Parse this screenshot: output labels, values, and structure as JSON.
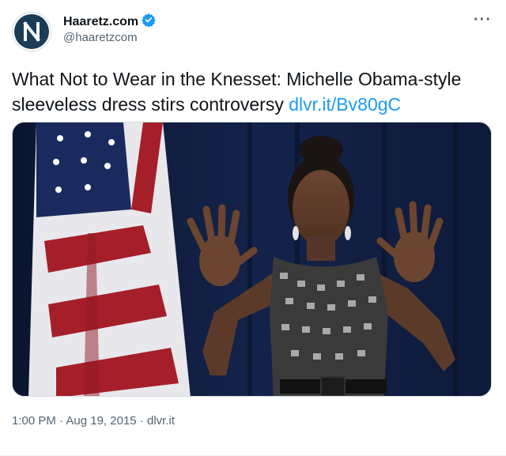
{
  "author": {
    "name": "Haaretz.com",
    "handle": "@haaretzcom",
    "verified": true,
    "avatar_icon": "haaretz-logo-icon"
  },
  "more_icon": "more-options-icon",
  "tweet": {
    "text": "What Not to Wear in the Knesset: Michelle Obama-style sleeveless dress stirs controversy ",
    "link": "dlvr.it/Bv80gC"
  },
  "media": {
    "kind": "photo"
  },
  "meta": {
    "time": "1:00 PM",
    "date": "Aug 19, 2015",
    "source": "dlvr.it",
    "separator": " · "
  },
  "colors": {
    "link": "#1d9bf0",
    "verified": "#1d9bf0",
    "muted": "#536471",
    "text": "#0f1419"
  }
}
